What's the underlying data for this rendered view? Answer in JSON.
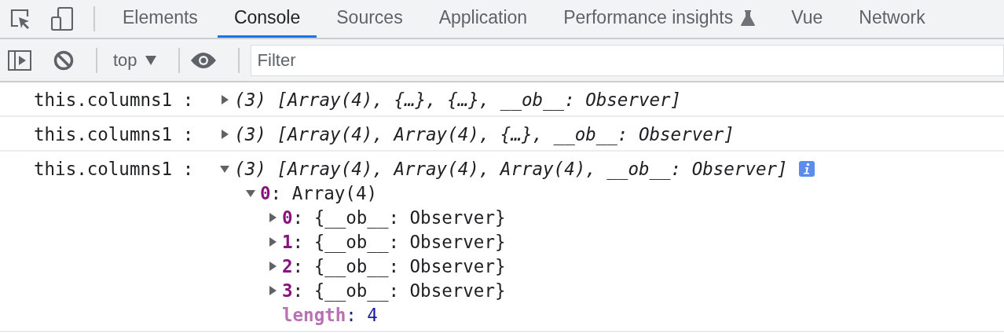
{
  "tabs": [
    {
      "label": "Elements",
      "selected": false,
      "experimental": false
    },
    {
      "label": "Console",
      "selected": true,
      "experimental": false
    },
    {
      "label": "Sources",
      "selected": false,
      "experimental": false
    },
    {
      "label": "Application",
      "selected": false,
      "experimental": false
    },
    {
      "label": "Performance insights",
      "selected": false,
      "experimental": true
    },
    {
      "label": "Vue",
      "selected": false,
      "experimental": false
    },
    {
      "label": "Network",
      "selected": false,
      "experimental": false
    }
  ],
  "toolbar": {
    "context": "top",
    "filter": {
      "placeholder": "Filter"
    }
  },
  "messages": [
    {
      "label": "this.columns1 :",
      "preview": "(3) [Array(4), {…}, {…}, __ob__: Observer]",
      "expanded": false,
      "info": false
    },
    {
      "label": "this.columns1 :",
      "preview": "(3) [Array(4), Array(4), {…}, __ob__: Observer]",
      "expanded": false,
      "info": false
    },
    {
      "label": "this.columns1 :",
      "preview": "(3) [Array(4), Array(4), Array(4), __ob__: Observer]",
      "expanded": true,
      "info": true,
      "children": [
        {
          "kind": "index",
          "entry": "**0**: Array(4)",
          "expanded": true,
          "children": [
            {
              "kind": "index",
              "entry": "**0**: {__ob__: Observer}",
              "expanded": false
            },
            {
              "kind": "index",
              "entry": "**1**: {__ob__: Observer}",
              "expanded": false
            },
            {
              "kind": "index",
              "entry": "**2**: {__ob__: Observer}",
              "expanded": false
            },
            {
              "kind": "index",
              "entry": "**3**: {__ob__: Observer}",
              "expanded": false
            },
            {
              "kind": "hidden",
              "entry": "**length**: 4"
            }
          ]
        }
      ]
    }
  ]
}
